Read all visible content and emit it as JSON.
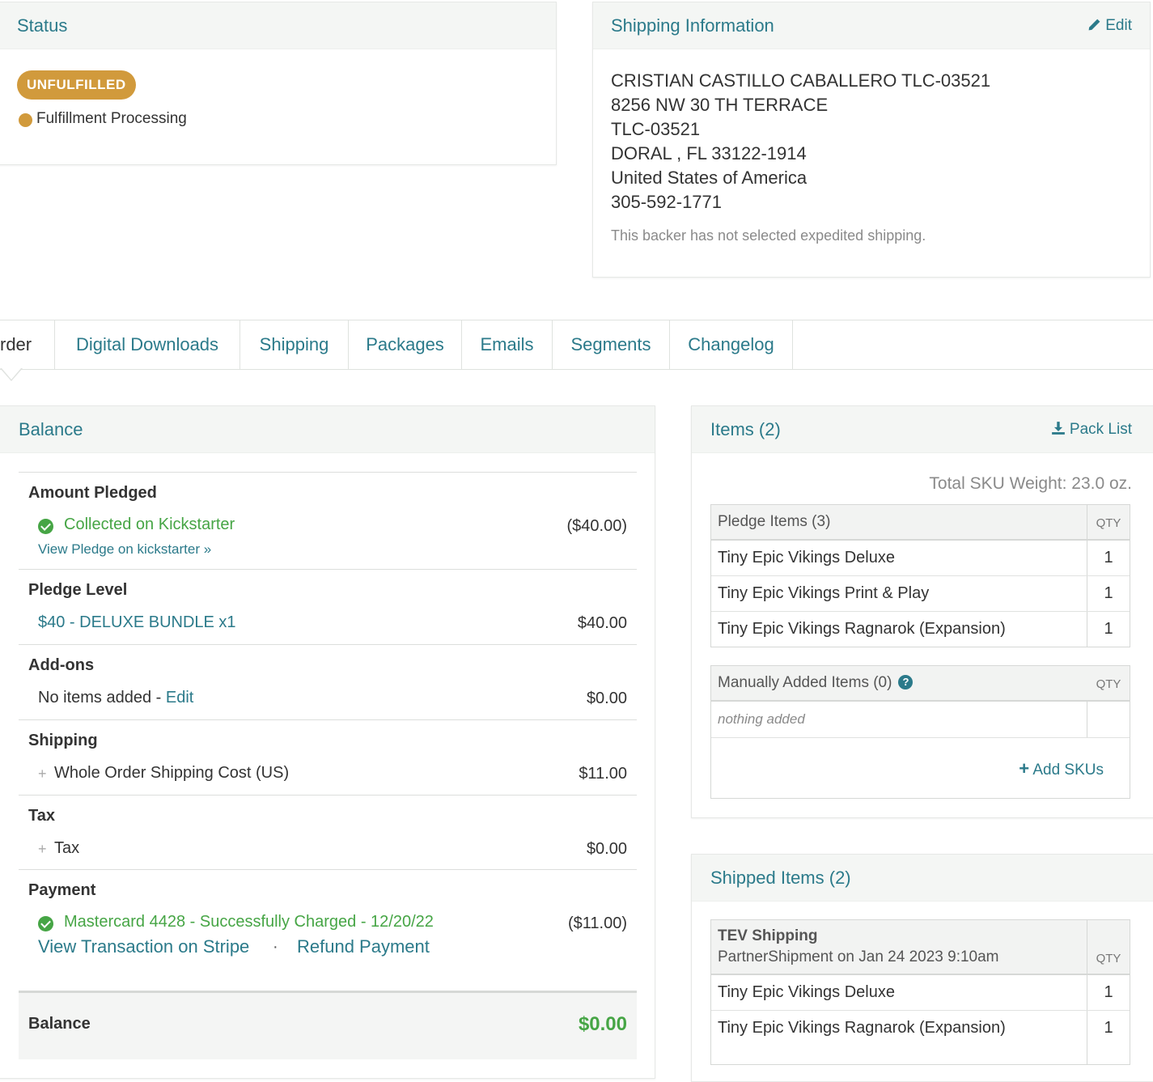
{
  "status": {
    "title": "Status",
    "badge": "UNFULFILLED",
    "fulfillment": "Fulfillment Processing",
    "colors": {
      "badge": "#d19a3c",
      "accent": "#2b7a8a",
      "success": "#46a545"
    }
  },
  "shipping_info": {
    "title": "Shipping Information",
    "edit_label": "Edit",
    "edit_icon": "pencil-icon",
    "address_lines": [
      "CRISTIAN CASTILLO CABALLERO TLC-03521",
      "8256 NW 30 TH TERRACE",
      "TLC-03521",
      "DORAL , FL 33122-1914",
      "United States of America",
      "305-592-1771"
    ],
    "note": "This backer has not selected expedited shipping."
  },
  "tabs": [
    {
      "label": "rder",
      "active": true
    },
    {
      "label": "Digital Downloads"
    },
    {
      "label": "Shipping"
    },
    {
      "label": "Packages"
    },
    {
      "label": "Emails"
    },
    {
      "label": "Segments"
    },
    {
      "label": "Changelog"
    }
  ],
  "balance": {
    "title": "Balance",
    "amount_pledged": {
      "title": "Amount Pledged",
      "status": "Collected on Kickstarter",
      "amount": "($40.00)",
      "link": "View Pledge on kickstarter »"
    },
    "pledge_level": {
      "title": "Pledge Level",
      "name": "$40 - DELUXE BUNDLE x1",
      "amount": "$40.00"
    },
    "addons": {
      "title": "Add-ons",
      "text": "No items added - ",
      "edit_label": "Edit",
      "amount": "$0.00"
    },
    "shipping": {
      "title": "Shipping",
      "item": "Whole Order Shipping Cost (US)",
      "amount": "$11.00"
    },
    "tax": {
      "title": "Tax",
      "item": "Tax",
      "amount": "$0.00"
    },
    "payment": {
      "title": "Payment",
      "status": "Mastercard 4428 - Successfully Charged - 12/20/22",
      "amount": "($11.00)",
      "stripe_link": "View Transaction on Stripe",
      "separator": "·",
      "refund_link": "Refund Payment"
    },
    "total": {
      "label": "Balance",
      "amount": "$0.00"
    }
  },
  "items": {
    "title": "Items (2)",
    "pack_list_label": "Pack List",
    "pack_list_icon": "download-icon",
    "total_weight": "Total SKU Weight: 23.0 oz.",
    "pledge_table": {
      "header": "Pledge Items (3)",
      "qty_label": "QTY",
      "rows": [
        {
          "name": "Tiny Epic Vikings Deluxe",
          "qty": "1"
        },
        {
          "name": "Tiny Epic Vikings Print & Play",
          "qty": "1"
        },
        {
          "name": "Tiny Epic Vikings Ragnarok (Expansion)",
          "qty": "1"
        }
      ]
    },
    "manual_table": {
      "header": "Manually Added Items (0)",
      "qty_label": "QTY",
      "empty_text": "nothing added",
      "add_label": "Add SKUs"
    }
  },
  "shipped": {
    "title": "Shipped Items (2)",
    "table": {
      "carrier": "TEV Shipping",
      "detail": "PartnerShipment on Jan 24 2023 9:10am",
      "qty_label": "QTY",
      "rows": [
        {
          "name": "Tiny Epic Vikings Deluxe",
          "qty": "1"
        },
        {
          "name": "Tiny Epic Vikings Ragnarok (Expansion)",
          "qty": "1"
        }
      ]
    }
  }
}
